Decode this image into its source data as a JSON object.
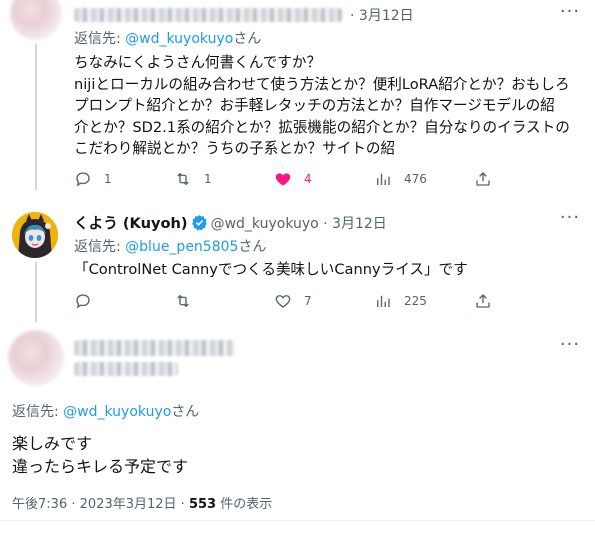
{
  "tweet1": {
    "date": "3月12日",
    "reply_label": "返信先:",
    "reply_handle": "@wd_kuyokuyo",
    "reply_suffix": "さん",
    "lines": [
      "ちなみにくようさん何書くんですか？",
      "nijiとローカルの組み合わせて使う方法とか？便利LoRA紹介とか？おもしろ",
      "プロンプト紹介とか？お手軽レタッチの方法とか？自作マージモデルの紹",
      "介とか？SD2.1系の紹介とか？拡張機能の紹介とか？自分なりのイラストの",
      "こだわり解説とか？うちの子系とか？サイトの紹"
    ],
    "actions": {
      "reply": "1",
      "retweet": "1",
      "like": "4",
      "views": "476"
    }
  },
  "tweet2": {
    "name": "くよう (Kuyoh)",
    "handle": "@wd_kuyokuyo",
    "dot": "·",
    "date": "3月12日",
    "reply_label": "返信先:",
    "reply_handle": "@blue_pen5805",
    "reply_suffix": "さん",
    "text": "「ControlNet Cannyでつくる美味しいCannyライス」です",
    "actions": {
      "reply": "",
      "retweet": "",
      "like": "7",
      "views": "225"
    }
  },
  "tweet3": {
    "reply_label": "返信先:",
    "reply_handle": "@wd_kuyokuyo",
    "reply_suffix": "さん",
    "lines": [
      "楽しみです",
      "違ったらキレる予定です"
    ],
    "time": "午後7:36",
    "dot": "·",
    "date": "2023年3月12日",
    "views_dot": "·",
    "views_count": "553",
    "views_label": "件の表示"
  },
  "colors": {
    "accent": "#1d9bf0",
    "like": "#f91880",
    "muted": "#536471",
    "text": "#0f1419"
  }
}
